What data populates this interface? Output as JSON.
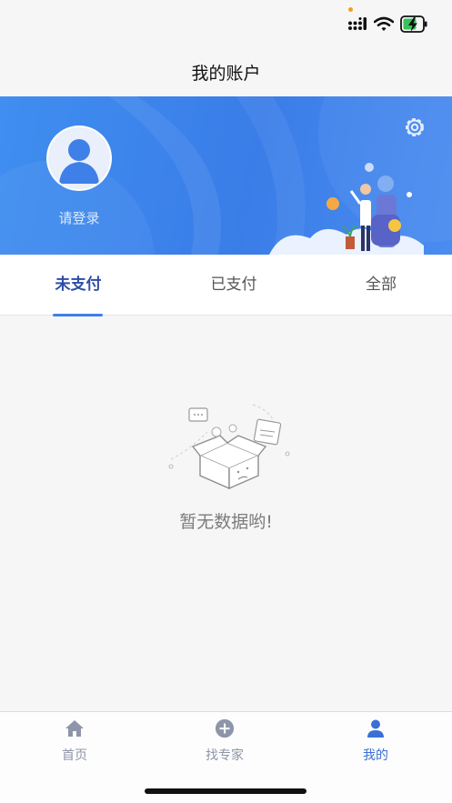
{
  "status_bar": {
    "signal_icon": "cellular-signal-icon",
    "wifi_icon": "wifi-icon",
    "battery_icon": "battery-charging-icon"
  },
  "header": {
    "title": "我的账户"
  },
  "profile": {
    "avatar_icon": "user-avatar-icon",
    "login_label": "请登录",
    "settings_icon": "gear-icon"
  },
  "tabs": [
    {
      "label": "未支付",
      "active": true
    },
    {
      "label": "已支付",
      "active": false
    },
    {
      "label": "全部",
      "active": false
    }
  ],
  "empty_state": {
    "icon": "empty-box-icon",
    "message": "暂无数据哟!"
  },
  "tabbar": {
    "items": [
      {
        "label": "首页",
        "icon": "home-icon",
        "active": false
      },
      {
        "label": "找专家",
        "icon": "plus-circle-icon",
        "active": false
      },
      {
        "label": "我的",
        "icon": "person-icon",
        "active": true
      }
    ]
  },
  "colors": {
    "accent": "#3f7fe8",
    "active_tab_text": "#2d4ea8",
    "banner_blue": "#3a7de8",
    "inactive_icon": "#8e95a8"
  }
}
